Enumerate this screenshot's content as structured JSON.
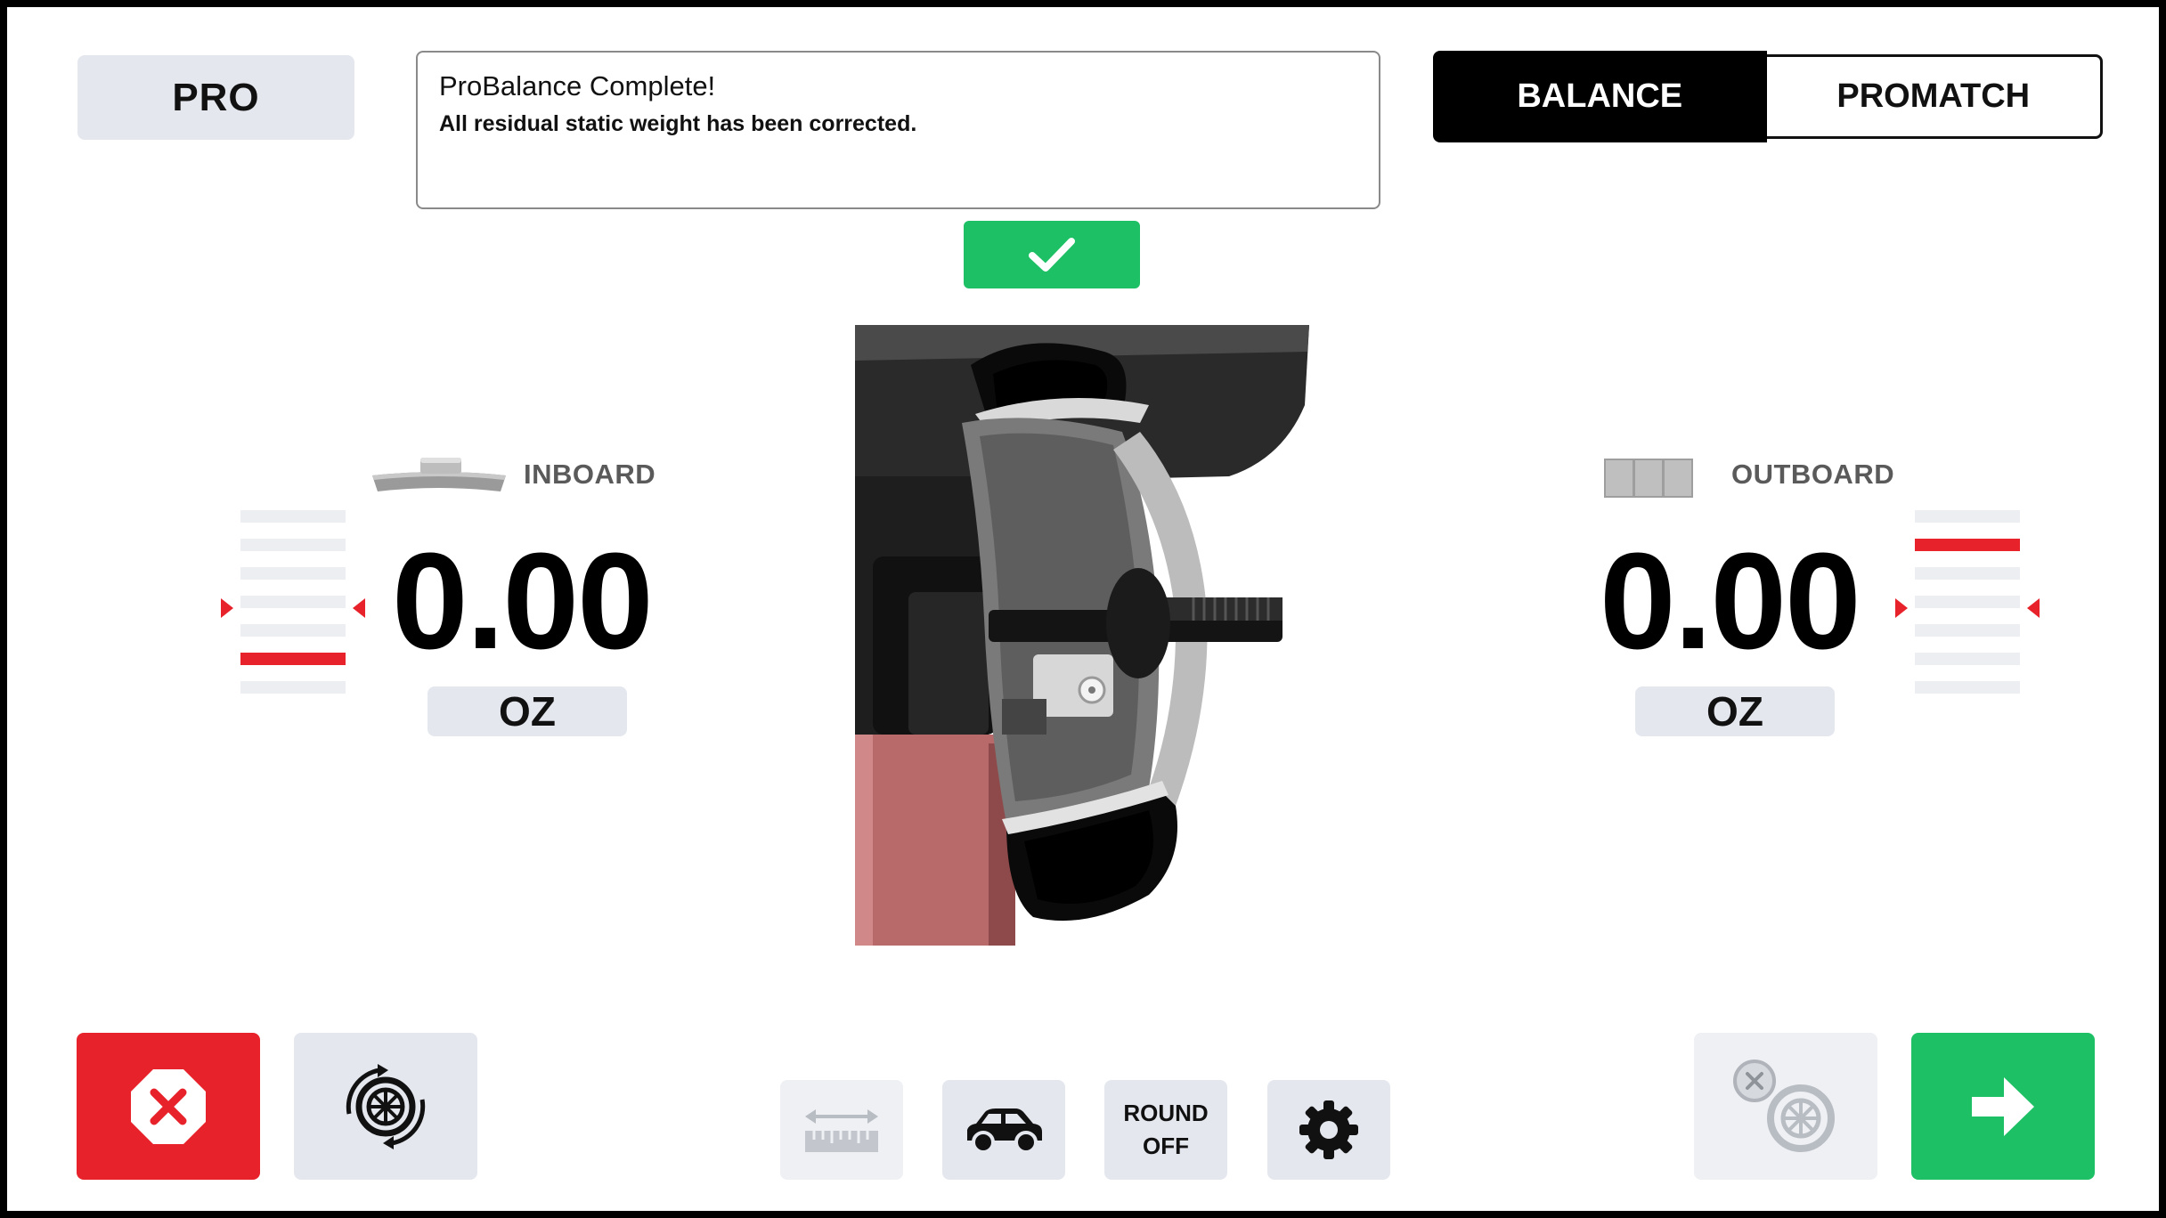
{
  "header": {
    "pro_label": "PRO",
    "message": {
      "title": "ProBalance Complete!",
      "body": "All residual static weight has been corrected."
    },
    "modes": {
      "balance": "BALANCE",
      "promatch": "PROMATCH",
      "active": "balance"
    }
  },
  "inboard": {
    "label": "INBOARD",
    "value": "0.00",
    "unit": "OZ",
    "weight_icon": "clip-on-weight-icon"
  },
  "outboard": {
    "label": "OUTBOARD",
    "value": "0.00",
    "unit": "OZ",
    "weight_icon": "adhesive-weight-icon"
  },
  "toolbar": {
    "stop_icon": "stop-x-icon",
    "spin_icon": "wheel-spin-icon",
    "measure_icon": "ruler-arrows-icon",
    "vehicle_icon": "car-icon",
    "round_off_line1": "ROUND",
    "round_off_line2": "OFF",
    "settings_icon": "gear-icon",
    "wheel_clear_icon": "wheel-clear-icon",
    "next_icon": "arrow-right-icon"
  },
  "colors": {
    "accent_green": "#1ec065",
    "alert_red": "#e8222b",
    "button_grey": "#e4e7ee"
  }
}
